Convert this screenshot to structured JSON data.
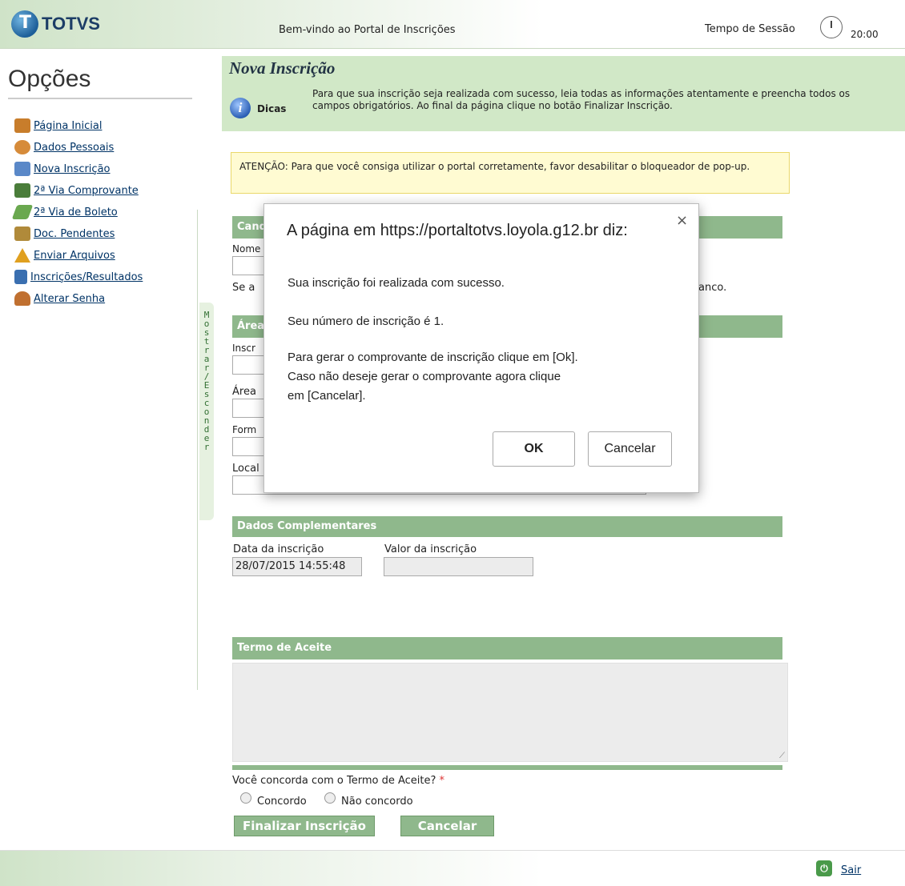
{
  "header": {
    "logo_text": "TOTVS",
    "welcome": "Bem-vindo ao Portal de Inscrições",
    "session_label": "Tempo de Sessão",
    "session_time": "20:00"
  },
  "sidebar": {
    "title": "Opções",
    "items": [
      {
        "label": "Página Inicial",
        "icon": "home-icon",
        "color": "#c87d2b"
      },
      {
        "label": "Dados Pessoais",
        "icon": "users-icon",
        "color": "#d68b3a"
      },
      {
        "label": "Nova Inscrição",
        "icon": "form-icon",
        "color": "#5a88c8"
      },
      {
        "label": "2ª Via Comprovante",
        "icon": "printer-icon",
        "color": "#4a7d3a"
      },
      {
        "label": "2ª Via de Boleto",
        "icon": "money-icon",
        "color": "#6aa84f"
      },
      {
        "label": "Doc. Pendentes",
        "icon": "document-icon",
        "color": "#b08a3a"
      },
      {
        "label": "Enviar Arquivos",
        "icon": "warning-icon",
        "color": "#e0a020"
      },
      {
        "label": "Inscrições/Resultados",
        "icon": "list-icon",
        "color": "#3a6fb0"
      },
      {
        "label": "Alterar Senha",
        "icon": "user-key-icon",
        "color": "#c07030"
      }
    ],
    "toggle_text": "Mostrar / Esconder"
  },
  "main": {
    "title": "Nova Inscrição",
    "tips_label": "Dicas",
    "tips_text": "Para que sua inscrição seja realizada com sucesso, leia todas as informações atentamente e preencha todos os campos obrigatórios. Ao final da página clique no botão Finalizar Inscrição.",
    "attention": "ATENÇÃO: Para que você consiga utilizar o portal corretamente, favor desabilitar o bloqueador de pop-up.",
    "section_candidate": "Cand",
    "field_nome": "Nome",
    "text_se_a": "Se a",
    "text_anco": "anco.",
    "section_area": "Área",
    "field_inscricao": "Inscr",
    "field_area": "Área",
    "field_forma": "Form",
    "field_local": "Local",
    "section_complementares": "Dados Complementares",
    "label_data": "Data da inscrição",
    "value_data": "28/07/2015 14:55:48",
    "label_valor": "Valor da inscrição",
    "value_valor": "",
    "section_termo": "Termo de Aceite",
    "question": "Você concorda com o Termo de Aceite?",
    "required_mark": "*",
    "option_agree": "Concordo",
    "option_disagree": "Não concordo",
    "btn_finalize": "Finalizar Inscrição",
    "btn_cancel": "Cancelar"
  },
  "modal": {
    "title": "A página em https://portaltotvs.loyola.g12.br diz:",
    "line1": "Sua inscrição foi realizada com sucesso.",
    "line2": "Seu número de inscrição é 1.",
    "line3": "Para gerar o comprovante de inscrição clique em [Ok].",
    "line4": "Caso não deseje gerar o comprovante agora clique",
    "line5": "em [Cancelar].",
    "ok": "OK",
    "cancel": "Cancelar",
    "close": "×"
  },
  "footer": {
    "logout": "Sair"
  }
}
